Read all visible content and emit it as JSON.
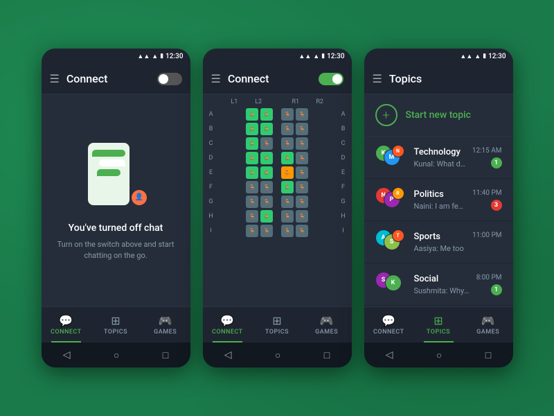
{
  "bg": {
    "color": "#1a7a4a"
  },
  "screens": [
    {
      "id": "screen1",
      "statusBar": {
        "time": "12:30"
      },
      "appBar": {
        "title": "Connect",
        "toggleState": "off"
      },
      "content": {
        "type": "chat-off",
        "title": "You've turned off chat",
        "description": "Turn on the switch above and start chatting on the go."
      },
      "bottomNav": {
        "items": [
          {
            "label": "CONNECT",
            "icon": "chat",
            "active": true
          },
          {
            "label": "TOPICS",
            "icon": "grid",
            "active": false
          },
          {
            "label": "GAMES",
            "icon": "gamepad",
            "active": false
          }
        ]
      }
    },
    {
      "id": "screen2",
      "statusBar": {
        "time": "12:30"
      },
      "appBar": {
        "title": "Connect",
        "toggleState": "on"
      },
      "content": {
        "type": "seating",
        "colLabels": [
          "L1",
          "L2",
          "",
          "R1",
          "R2"
        ],
        "rowLabels": [
          "A",
          "B",
          "C",
          "D",
          "E",
          "F",
          "G",
          "H",
          "I"
        ],
        "rows": [
          [
            "green",
            "green",
            "gap",
            "gray",
            "gray"
          ],
          [
            "green",
            "green",
            "gap",
            "gray",
            "gray"
          ],
          [
            "green",
            "gray",
            "gap",
            "gray",
            "gray"
          ],
          [
            "green",
            "green",
            "gap",
            "green",
            "gray"
          ],
          [
            "green",
            "green",
            "gap",
            "orange",
            "gray"
          ],
          [
            "gray",
            "gray",
            "gap",
            "green",
            "gray"
          ],
          [
            "gray",
            "gray",
            "gap",
            "gray",
            "gray"
          ],
          [
            "gray",
            "green",
            "gap",
            "gray",
            "gray"
          ],
          [
            "gray",
            "gray",
            "gap",
            "gray",
            "gray"
          ]
        ]
      },
      "bottomNav": {
        "items": [
          {
            "label": "CONNECT",
            "icon": "chat",
            "active": true
          },
          {
            "label": "TOPICS",
            "icon": "grid",
            "active": false
          },
          {
            "label": "GAMES",
            "icon": "gamepad",
            "active": false
          }
        ]
      }
    },
    {
      "id": "screen3",
      "statusBar": {
        "time": "12:30"
      },
      "appBar": {
        "title": "Topics"
      },
      "content": {
        "type": "topics",
        "newTopicLabel": "Start new topic",
        "topics": [
          {
            "name": "Technology",
            "preview": "Kunal: What do you think?",
            "time": "12:15 AM",
            "badge": "1",
            "badgeColor": "green",
            "avatarColors": [
              "#4CAF50",
              "#2196F3",
              "#FF5722"
            ]
          },
          {
            "name": "Politics",
            "preview": "Naini: I am feeling so Noob",
            "time": "11:40 PM",
            "badge": "3",
            "badgeColor": "red",
            "avatarColors": [
              "#e53935",
              "#9c27b0",
              "#ff9800"
            ]
          },
          {
            "name": "Sports",
            "preview": "Aasiya: Me too",
            "time": "11:00 PM",
            "badge": "",
            "badgeColor": "hidden",
            "avatarColors": [
              "#00bcd4",
              "#8bc34a",
              "#ff5722"
            ]
          },
          {
            "name": "Social",
            "preview": "Sushmita: Why am I here?",
            "time": "8:00 PM",
            "badge": "1",
            "badgeColor": "green",
            "avatarColors": [
              "#9c27b0",
              "#4CAF50"
            ]
          }
        ]
      },
      "bottomNav": {
        "items": [
          {
            "label": "CONNECT",
            "icon": "chat",
            "active": false
          },
          {
            "label": "TOPICS",
            "icon": "grid",
            "active": true
          },
          {
            "label": "GAMES",
            "icon": "gamepad",
            "active": false
          }
        ]
      }
    }
  ],
  "androidNav": {
    "back": "◁",
    "home": "○",
    "recent": "□"
  }
}
